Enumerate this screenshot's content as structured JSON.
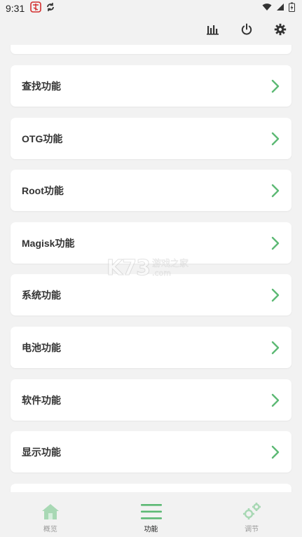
{
  "status_bar": {
    "time": "9:31"
  },
  "features": {
    "items": [
      {
        "label": "查找功能"
      },
      {
        "label": "OTG功能"
      },
      {
        "label": "Root功能"
      },
      {
        "label": "Magisk功能"
      },
      {
        "label": "系统功能"
      },
      {
        "label": "电池功能"
      },
      {
        "label": "软件功能"
      },
      {
        "label": "显示功能"
      }
    ]
  },
  "watermark": {
    "big": "K73",
    "cn": "游戏之家",
    "com": ".com"
  },
  "bottom_nav": {
    "items": [
      {
        "label": "概览",
        "icon": "home-icon"
      },
      {
        "label": "功能",
        "icon": "menu-icon"
      },
      {
        "label": "调节",
        "icon": "gears-icon"
      }
    ],
    "active_index": 1
  },
  "colors": {
    "accent_green": "#5cb974",
    "inactive_green": "#a8d8b4",
    "background": "#f2f2f2",
    "card": "#ffffff"
  }
}
